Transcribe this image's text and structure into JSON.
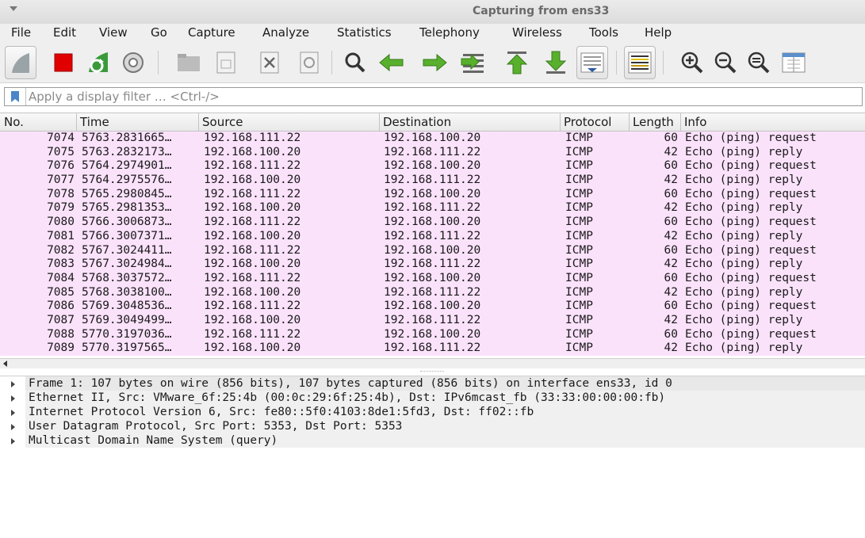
{
  "window": {
    "title": "Capturing from ens33"
  },
  "menu": {
    "items": [
      {
        "label": "File"
      },
      {
        "label": "Edit"
      },
      {
        "label": "View"
      },
      {
        "label": "Go"
      },
      {
        "label": "Capture"
      },
      {
        "label": "Analyze"
      },
      {
        "label": "Statistics"
      },
      {
        "label": "Telephony"
      },
      {
        "label": "Wireless"
      },
      {
        "label": "Tools"
      },
      {
        "label": "Help"
      }
    ]
  },
  "toolbar": {
    "buttons": [
      "start-capture-icon",
      "stop-capture-icon",
      "restart-capture-icon",
      "capture-options-icon",
      "open-file-icon",
      "save-file-icon",
      "close-file-icon",
      "reload-file-icon",
      "find-packet-icon",
      "go-back-icon",
      "go-forward-icon",
      "go-to-packet-icon",
      "go-first-packet-icon",
      "go-last-packet-icon",
      "autoscroll-icon",
      "colorize-icon",
      "zoom-in-icon",
      "zoom-out-icon",
      "zoom-normal-icon",
      "resize-columns-icon"
    ]
  },
  "filter": {
    "placeholder": "Apply a display filter … <Ctrl-/>"
  },
  "packet_list": {
    "columns": [
      "No.",
      "Time",
      "Source",
      "Destination",
      "Protocol",
      "Length",
      "Info"
    ],
    "rows": [
      {
        "no": "7074",
        "time": "5763.2831665…",
        "src": "192.168.111.22",
        "dst": "192.168.100.20",
        "proto": "ICMP",
        "len": "60",
        "info": "Echo (ping) request"
      },
      {
        "no": "7075",
        "time": "5763.2832173…",
        "src": "192.168.100.20",
        "dst": "192.168.111.22",
        "proto": "ICMP",
        "len": "42",
        "info": "Echo (ping) reply"
      },
      {
        "no": "7076",
        "time": "5764.2974901…",
        "src": "192.168.111.22",
        "dst": "192.168.100.20",
        "proto": "ICMP",
        "len": "60",
        "info": "Echo (ping) request"
      },
      {
        "no": "7077",
        "time": "5764.2975576…",
        "src": "192.168.100.20",
        "dst": "192.168.111.22",
        "proto": "ICMP",
        "len": "42",
        "info": "Echo (ping) reply"
      },
      {
        "no": "7078",
        "time": "5765.2980845…",
        "src": "192.168.111.22",
        "dst": "192.168.100.20",
        "proto": "ICMP",
        "len": "60",
        "info": "Echo (ping) request"
      },
      {
        "no": "7079",
        "time": "5765.2981353…",
        "src": "192.168.100.20",
        "dst": "192.168.111.22",
        "proto": "ICMP",
        "len": "42",
        "info": "Echo (ping) reply"
      },
      {
        "no": "7080",
        "time": "5766.3006873…",
        "src": "192.168.111.22",
        "dst": "192.168.100.20",
        "proto": "ICMP",
        "len": "60",
        "info": "Echo (ping) request"
      },
      {
        "no": "7081",
        "time": "5766.3007371…",
        "src": "192.168.100.20",
        "dst": "192.168.111.22",
        "proto": "ICMP",
        "len": "42",
        "info": "Echo (ping) reply"
      },
      {
        "no": "7082",
        "time": "5767.3024411…",
        "src": "192.168.111.22",
        "dst": "192.168.100.20",
        "proto": "ICMP",
        "len": "60",
        "info": "Echo (ping) request"
      },
      {
        "no": "7083",
        "time": "5767.3024984…",
        "src": "192.168.100.20",
        "dst": "192.168.111.22",
        "proto": "ICMP",
        "len": "42",
        "info": "Echo (ping) reply"
      },
      {
        "no": "7084",
        "time": "5768.3037572…",
        "src": "192.168.111.22",
        "dst": "192.168.100.20",
        "proto": "ICMP",
        "len": "60",
        "info": "Echo (ping) request"
      },
      {
        "no": "7085",
        "time": "5768.3038100…",
        "src": "192.168.100.20",
        "dst": "192.168.111.22",
        "proto": "ICMP",
        "len": "42",
        "info": "Echo (ping) reply"
      },
      {
        "no": "7086",
        "time": "5769.3048536…",
        "src": "192.168.111.22",
        "dst": "192.168.100.20",
        "proto": "ICMP",
        "len": "60",
        "info": "Echo (ping) request"
      },
      {
        "no": "7087",
        "time": "5769.3049499…",
        "src": "192.168.100.20",
        "dst": "192.168.111.22",
        "proto": "ICMP",
        "len": "42",
        "info": "Echo (ping) reply"
      },
      {
        "no": "7088",
        "time": "5770.3197036…",
        "src": "192.168.111.22",
        "dst": "192.168.100.20",
        "proto": "ICMP",
        "len": "60",
        "info": "Echo (ping) request"
      },
      {
        "no": "7089",
        "time": "5770.3197565…",
        "src": "192.168.100.20",
        "dst": "192.168.111.22",
        "proto": "ICMP",
        "len": "42",
        "info": "Echo (ping) reply"
      }
    ],
    "row_color": "#fbe2fb"
  },
  "details": {
    "lines": [
      "Frame 1: 107 bytes on wire (856 bits), 107 bytes captured (856 bits) on interface ens33, id 0",
      "Ethernet II, Src: VMware_6f:25:4b (00:0c:29:6f:25:4b), Dst: IPv6mcast_fb (33:33:00:00:00:fb)",
      "Internet Protocol Version 6, Src: fe80::5f0:4103:8de1:5fd3, Dst: ff02::fb",
      "User Datagram Protocol, Src Port: 5353, Dst Port: 5353",
      "Multicast Domain Name System (query)"
    ]
  }
}
